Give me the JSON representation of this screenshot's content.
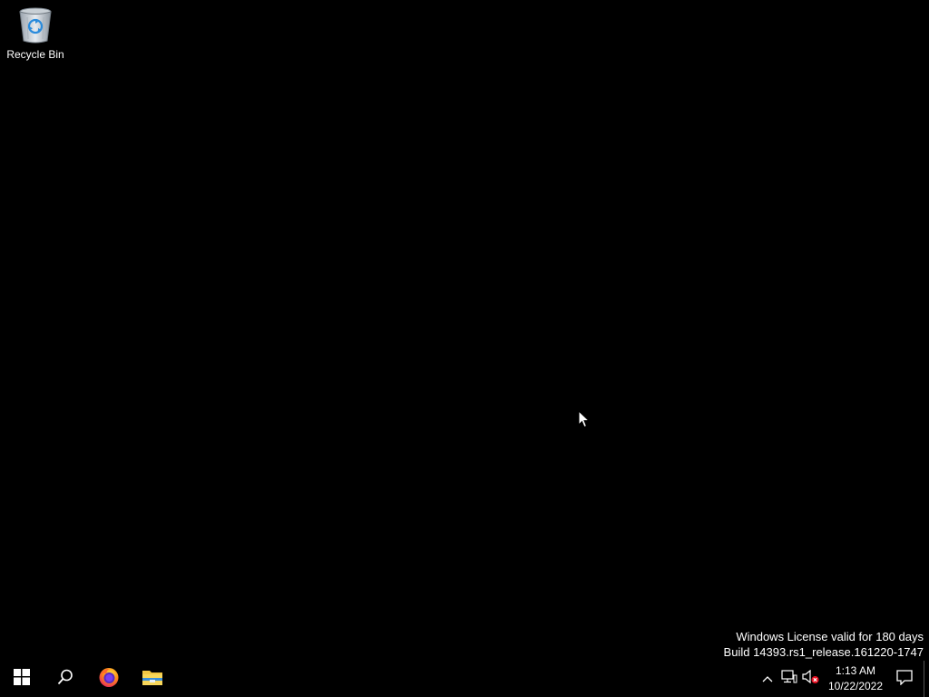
{
  "desktop": {
    "icons": [
      {
        "label": "Recycle Bin",
        "icon": "recycle-bin-icon"
      }
    ],
    "watermark": {
      "line1": "Windows License valid for 180 days",
      "line2": "Build 14393.rs1_release.161220-1747"
    }
  },
  "taskbar": {
    "start_icon": "windows-logo-icon",
    "search_icon": "search-icon",
    "pinned": [
      {
        "icon": "firefox-icon"
      },
      {
        "icon": "file-explorer-icon"
      }
    ],
    "tray": {
      "icons": [
        "chevron-up-icon",
        "network-icon",
        "volume-muted-icon"
      ],
      "time": "1:13 AM",
      "date": "10/22/2022",
      "action_center_icon": "notification-icon"
    }
  },
  "colors": {
    "background": "#000000",
    "text": "#ffffff",
    "accent_blue": "#0078d7"
  }
}
